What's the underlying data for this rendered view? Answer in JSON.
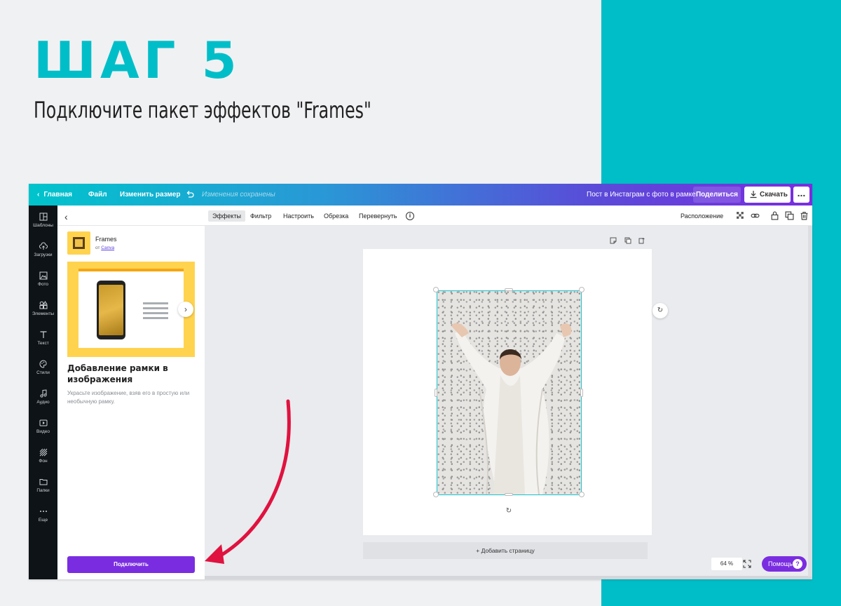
{
  "slide": {
    "step_title": "ШАГ 5",
    "step_subtitle": "Подключите пакет эффектов \"Frames\""
  },
  "colors": {
    "teal": "#00bec8",
    "purple": "#7a2de0",
    "selection": "#17c4cf",
    "arrow": "#e0123f"
  },
  "topbar": {
    "home": "Главная",
    "file": "Файл",
    "resize": "Изменить размер",
    "saved": "Изменения сохранены",
    "design_title": "Пост в Инстаграм с фото в рамке",
    "share": "Поделиться",
    "download": "Скачать",
    "more": "..."
  },
  "sidebar": {
    "items": [
      {
        "label": "Шаблоны",
        "icon": "templates-icon"
      },
      {
        "label": "Загрузки",
        "icon": "upload-cloud-icon"
      },
      {
        "label": "Фото",
        "icon": "photo-icon"
      },
      {
        "label": "Элементы",
        "icon": "shapes-icon"
      },
      {
        "label": "Текст",
        "icon": "text-icon"
      },
      {
        "label": "Стили",
        "icon": "palette-icon"
      },
      {
        "label": "Аудио",
        "icon": "music-note-icon"
      },
      {
        "label": "Видео",
        "icon": "video-icon"
      },
      {
        "label": "Фон",
        "icon": "background-pattern-icon"
      },
      {
        "label": "Папки",
        "icon": "folder-icon"
      },
      {
        "label": "Еще",
        "icon": "more-dots-icon"
      }
    ]
  },
  "panel": {
    "app_name": "Frames",
    "by_prefix": "от",
    "by_link": "Canva",
    "title": "Добавление рамки в изображения",
    "description": "Украсьте изображение, взяв его в простую или необычную рамку.",
    "connect": "Подключить"
  },
  "toolbar": {
    "effects": "Эффекты",
    "filter": "Фильтр",
    "adjust": "Настроить",
    "crop": "Обрезка",
    "flip": "Перевернуть",
    "info": "i",
    "position": "Расположение"
  },
  "canvas": {
    "add_page": "+ Добавить страницу",
    "zoom": "64 %",
    "help": "Помощь",
    "help_q": "?"
  }
}
